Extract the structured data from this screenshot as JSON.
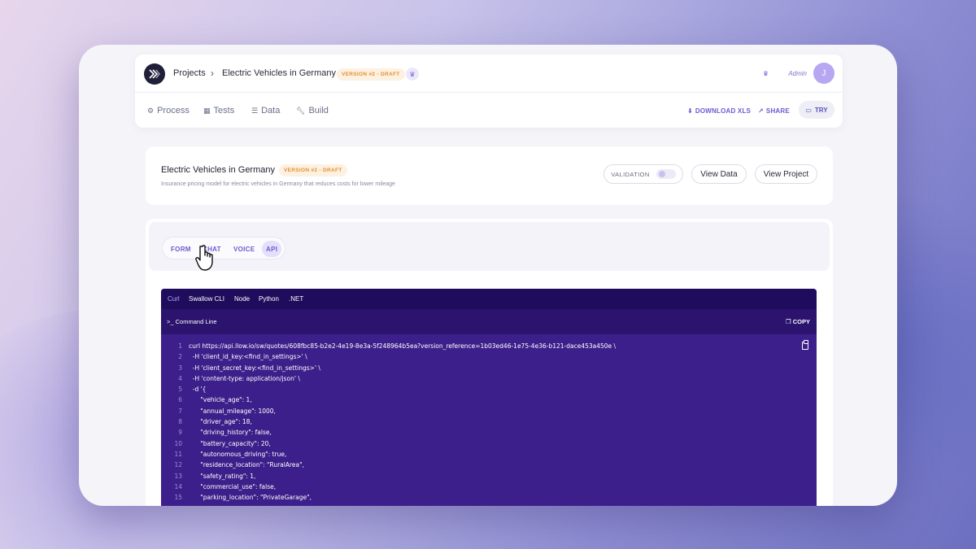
{
  "header": {
    "breadcrumb_root": "Projects",
    "project_name": "Electric Vehicles in Germany",
    "version_badge": "VERSION #2 - DRAFT",
    "role_label": "Admin",
    "avatar_initial": "J"
  },
  "nav": {
    "tabs": [
      {
        "label": "Process",
        "icon": "gear-icon"
      },
      {
        "label": "Tests",
        "icon": "tests-icon"
      },
      {
        "label": "Data",
        "icon": "database-icon"
      },
      {
        "label": "Build",
        "icon": "wrench-icon"
      }
    ],
    "download_label": "DOWNLOAD XLS",
    "share_label": "SHARE",
    "try_label": "TRY"
  },
  "project": {
    "title": "Electric Vehicles in Germany",
    "version_badge": "VERSION #2 - DRAFT",
    "description": "Insurance pricing model for electric vehicles in Germany that reduces costs for lower mileage",
    "validation_label": "VALIDATION",
    "validation_enabled": false,
    "view_data_label": "View Data",
    "view_project_label": "View Project"
  },
  "modes": {
    "items": [
      "FORM",
      "CHAT",
      "VOICE",
      "API"
    ],
    "active": "API"
  },
  "code": {
    "languages": [
      "Curl",
      "Swallow CLI",
      "Node",
      "Python",
      ".NET"
    ],
    "active_language": "Curl",
    "section_label": "Command Line",
    "copy_label": "COPY",
    "lines": [
      "curl https://api.llow.io/sw/quotes/608fbc85-b2e2-4e19-8e3a-5f248964b5ea?version_reference=1b03ed46-1e75-4e36-b121-dace453a450e \\",
      "  -H 'client_id_key:<find_in_settings>' \\",
      "  -H 'client_secret_key:<find_in_settings>' \\",
      "  -H 'content-type: application/json' \\",
      "  -d '{",
      "      \"vehicle_age\": 1,",
      "      \"annual_mileage\": 1000,",
      "      \"driver_age\": 18,",
      "      \"driving_history\": false,",
      "      \"battery_capacity\": 20,",
      "      \"autonomous_driving\": true,",
      "      \"residence_location\": \"RuralArea\",",
      "      \"safety_rating\": 1,",
      "      \"commercial_use\": false,",
      "      \"parking_location\": \"PrivateGarage\","
    ]
  },
  "colors": {
    "accent": "#6b5bd0",
    "badge_text": "#e3912f",
    "code_bg": "#3c1f8a",
    "code_header_bg": "#1f0c5c"
  }
}
